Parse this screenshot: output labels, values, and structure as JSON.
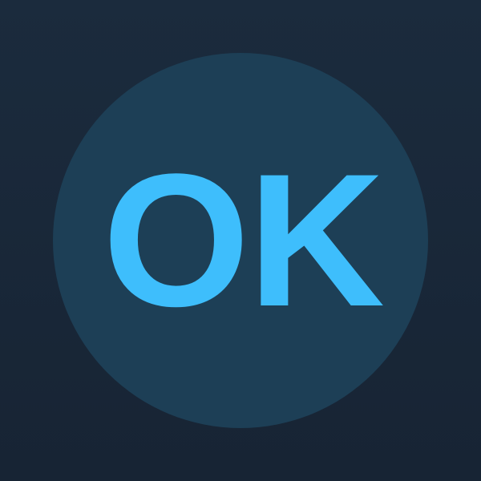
{
  "badge": {
    "label": "OK",
    "circle_color": "#1d3f56",
    "text_color": "#3ebefc"
  }
}
